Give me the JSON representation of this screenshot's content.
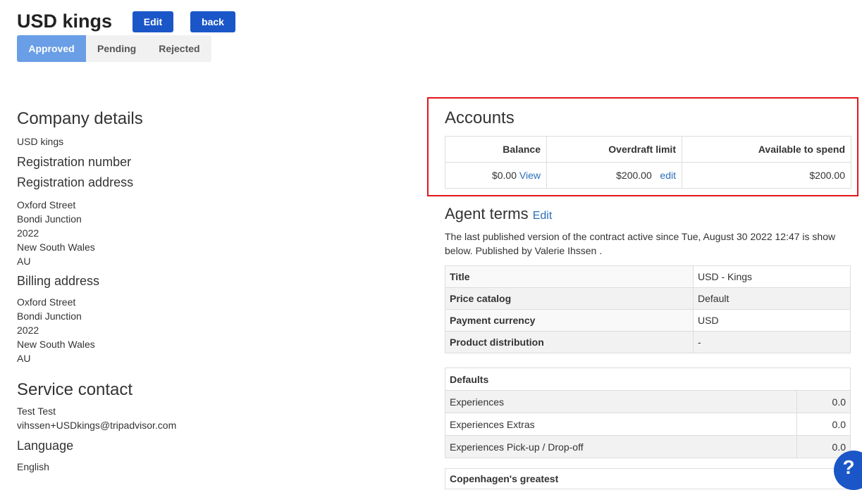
{
  "header": {
    "title": "USD kings",
    "edit_label": "Edit",
    "back_label": "back",
    "tabs": [
      {
        "label": "Approved",
        "active": true
      },
      {
        "label": "Pending",
        "active": false
      },
      {
        "label": "Rejected",
        "active": false
      }
    ]
  },
  "company": {
    "heading": "Company details",
    "name": "USD kings",
    "registration_number_label": "Registration number",
    "registration_address_label": "Registration address",
    "registration_address": [
      "Oxford Street",
      "Bondi Junction",
      "2022",
      "New South Wales",
      "AU"
    ],
    "billing_address_label": "Billing address",
    "billing_address": [
      "Oxford Street",
      "Bondi Junction",
      "2022",
      "New South Wales",
      "AU"
    ],
    "service_contact_heading": "Service contact",
    "service_contact_name": "Test Test",
    "service_contact_email": "vihssen+USDkings@tripadvisor.com",
    "language_label": "Language",
    "language_value": "English"
  },
  "accounts": {
    "heading": "Accounts",
    "headers": [
      "Balance",
      "Overdraft limit",
      "Available to spend"
    ],
    "balance_value": "$0.00",
    "balance_link": "View",
    "overdraft_value": "$200.00",
    "overdraft_link": "edit",
    "available_value": "$200.00"
  },
  "agent_terms": {
    "heading": "Agent terms",
    "edit_label": "Edit",
    "description": "The last published version of the contract active since Tue, August 30 2022 12:47 is show below. Published by Valerie Ihssen .",
    "rows": [
      {
        "key": "Title",
        "value": "USD - Kings"
      },
      {
        "key": "Price catalog",
        "value": "Default"
      },
      {
        "key": "Payment currency",
        "value": "USD"
      },
      {
        "key": "Product distribution",
        "value": "-"
      }
    ],
    "defaults_heading": "Defaults",
    "defaults": [
      {
        "key": "Experiences",
        "value": "0.0"
      },
      {
        "key": "Experiences Extras",
        "value": "0.0"
      },
      {
        "key": "Experiences Pick-up / Drop-off",
        "value": "0.0"
      }
    ],
    "next_table_heading": "Copenhagen's greatest"
  },
  "help": {
    "label": "?"
  }
}
